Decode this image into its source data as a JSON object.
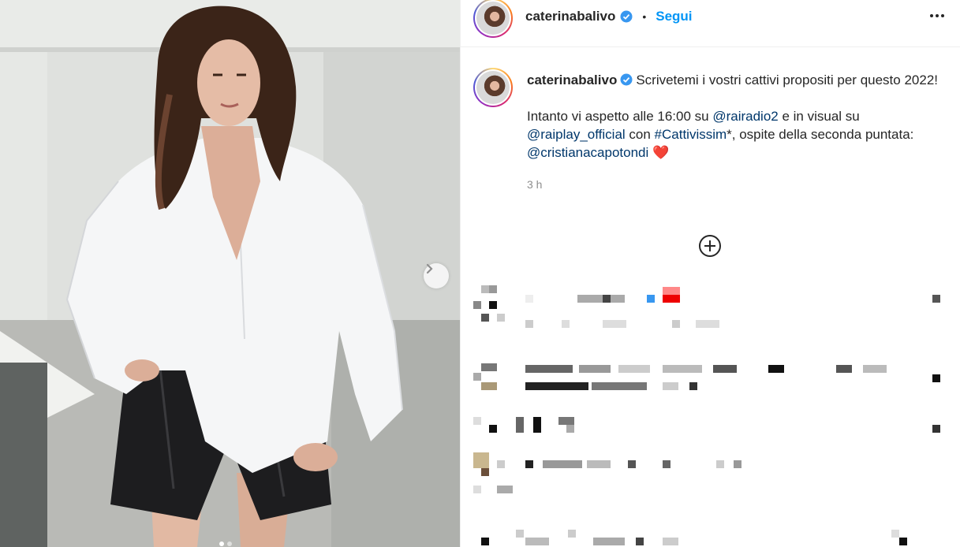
{
  "post": {
    "username": "caterinabalivo",
    "follow_label": "Segui",
    "separator": "•",
    "caption": {
      "line1": "Scrivetemi i vostri cattivi propositi per questo 2022!",
      "intro": "Intanto vi aspetto alle 16:00 su ",
      "mention1": "@rairadio2",
      "mid1": " e in visual su ",
      "mention2": "@raiplay_official",
      "mid2": " con ",
      "hashtag": "#Cattivissim",
      "mid3": "*, ospite della seconda puntata: ",
      "mention3": "@cristianacapotondi",
      "emoji": "❤️"
    },
    "time": "3 h"
  },
  "colors": {
    "accent": "#0095f6",
    "mention": "#00376b",
    "verified": "#3897f0",
    "heart": "#ed1c24"
  },
  "icons": [
    "verified-badge-icon",
    "more-options-icon",
    "add-comment-icon",
    "chevron-right-icon"
  ]
}
